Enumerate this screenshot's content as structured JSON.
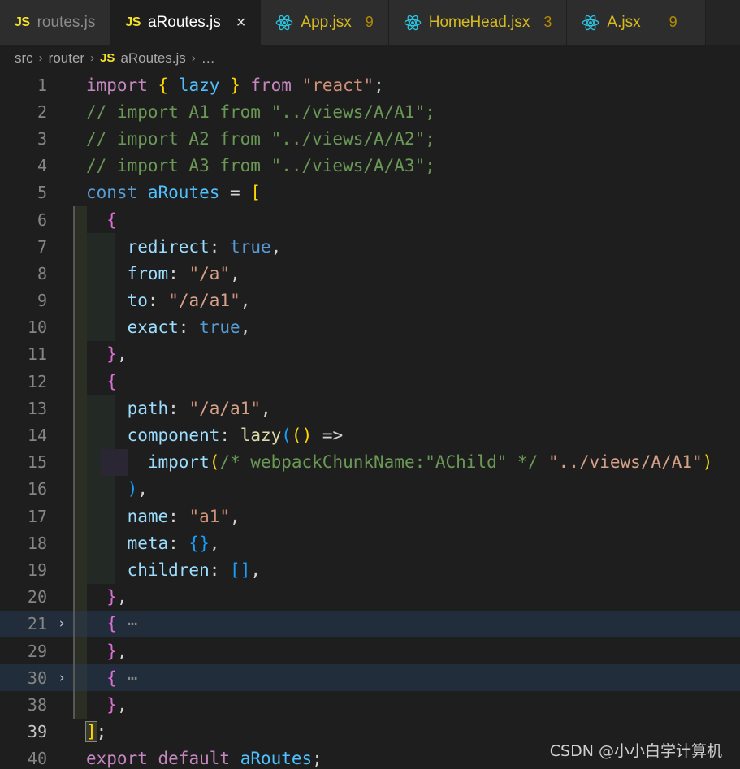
{
  "tabs": [
    {
      "icon": "js-file-icon",
      "label": "routes.js",
      "active": false,
      "badge": "",
      "closable": false,
      "label_style": "dim"
    },
    {
      "icon": "js-file-icon",
      "label": "aRoutes.js",
      "active": true,
      "badge": "",
      "closable": true,
      "close_label": "×",
      "label_style": "wht"
    },
    {
      "icon": "react-file-icon",
      "label": "App.jsx",
      "active": false,
      "badge": "9",
      "closable": false,
      "label_style": "yel"
    },
    {
      "icon": "react-file-icon",
      "label": "HomeHead.jsx",
      "active": false,
      "badge": "3",
      "closable": false,
      "label_style": "yel"
    },
    {
      "icon": "react-file-icon",
      "label": "A.jsx",
      "active": false,
      "badge": "9",
      "closable": false,
      "label_style": "yel"
    }
  ],
  "breadcrumb": {
    "items": [
      "src",
      "router",
      "aRoutes.js",
      "…"
    ],
    "separator": "›",
    "file_icon_label": "JS"
  },
  "editor": {
    "language": "javascript",
    "file_name": "aRoutes.js",
    "active_line": 39,
    "lines": [
      {
        "n": "1",
        "fold": "",
        "text": "import { lazy } from \"react\";"
      },
      {
        "n": "2",
        "fold": "",
        "text": "// import A1 from \"../views/A/A1\";"
      },
      {
        "n": "3",
        "fold": "",
        "text": "// import A2 from \"../views/A/A2\";"
      },
      {
        "n": "4",
        "fold": "",
        "text": "// import A3 from \"../views/A/A3\";"
      },
      {
        "n": "5",
        "fold": "",
        "text": "const aRoutes = ["
      },
      {
        "n": "6",
        "fold": "",
        "text": "  {"
      },
      {
        "n": "7",
        "fold": "",
        "text": "    redirect: true,"
      },
      {
        "n": "8",
        "fold": "",
        "text": "    from: \"/a\","
      },
      {
        "n": "9",
        "fold": "",
        "text": "    to: \"/a/a1\","
      },
      {
        "n": "10",
        "fold": "",
        "text": "    exact: true,"
      },
      {
        "n": "11",
        "fold": "",
        "text": "  },"
      },
      {
        "n": "12",
        "fold": "",
        "text": "  {"
      },
      {
        "n": "13",
        "fold": "",
        "text": "    path: \"/a/a1\","
      },
      {
        "n": "14",
        "fold": "",
        "text": "    component: lazy(() =>"
      },
      {
        "n": "15",
        "fold": "",
        "text": "      import(/* webpackChunkName:\"AChild\" */ \"../views/A/A1\")"
      },
      {
        "n": "16",
        "fold": "",
        "text": "    ),"
      },
      {
        "n": "17",
        "fold": "",
        "text": "    name: \"a1\","
      },
      {
        "n": "18",
        "fold": "",
        "text": "    meta: {},"
      },
      {
        "n": "19",
        "fold": "",
        "text": "    children: [],"
      },
      {
        "n": "20",
        "fold": "",
        "text": "  },"
      },
      {
        "n": "21",
        "fold": "›",
        "text": "  { ⋯"
      },
      {
        "n": "29",
        "fold": "",
        "text": "  },"
      },
      {
        "n": "30",
        "fold": "›",
        "text": "  { ⋯"
      },
      {
        "n": "38",
        "fold": "",
        "text": "  },"
      },
      {
        "n": "39",
        "fold": "",
        "text": "];"
      },
      {
        "n": "40",
        "fold": "",
        "text": "export default aRoutes;"
      }
    ]
  },
  "watermark": {
    "text": "CSDN @小小白学计算机"
  },
  "colors": {
    "editor_background": "#1e1e1e",
    "tabbar_background": "#252526",
    "inactive_tab_background": "#2d2d2d",
    "line_number": "#858585",
    "keyword": "#c586c0",
    "control_keyword": "#569cd6",
    "variable": "#9cdcfe",
    "string": "#ce9178",
    "comment": "#6a9955",
    "function": "#dcdcaa",
    "bracket_level1": "#ffd700",
    "bracket_level2": "#da70d6",
    "bracket_level3": "#179fff",
    "folded_line_background": "#212d3a",
    "js_icon": "#f5e12a",
    "react_icon": "#2ac3de",
    "badge": "#b58900"
  }
}
